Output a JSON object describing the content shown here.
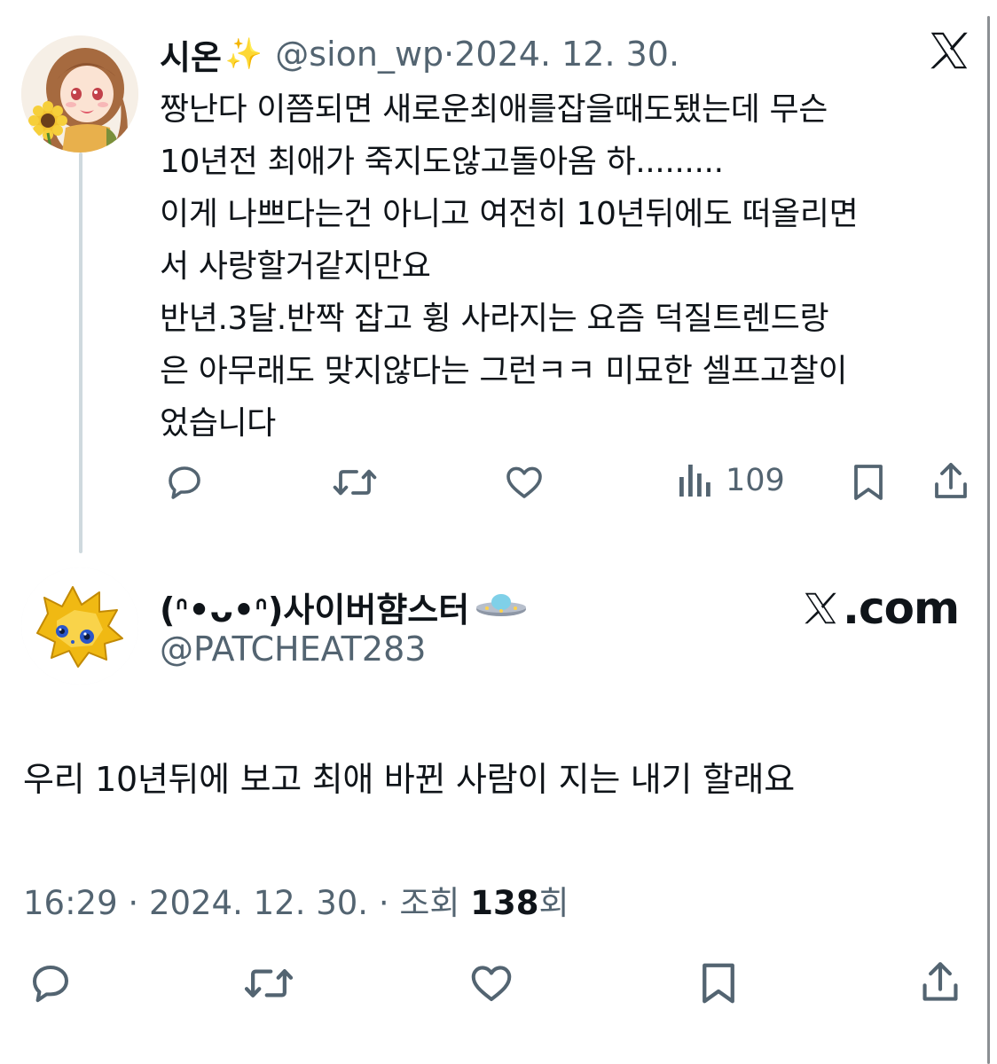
{
  "tweet": {
    "author_name": "시온",
    "author_emoji": "✨",
    "handle": "@sion_wp",
    "separator": " · ",
    "date": "2024. 12. 30.",
    "text": "짱난다 이쯤되면 새로운최애를잡을때도됐는데 무슨\n10년전 최애가 죽지도않고돌아옴 하.........\n이게 나쁘다는건 아니고 여전히 10년뒤에도 떠올리면\n서 사랑할거같지만요\n반년.3달.반짝 잡고 휭 사라지는 요즘 덕질트렌드랑\n은 아무래도 맞지않다는 그런ㅋㅋ 미묘한 셀프고찰이\n었습니다",
    "views": "109"
  },
  "reply": {
    "author_name": "(ᐢ•ᴗ•ᐢ)사이버햠스터",
    "author_emoji": "🛸",
    "handle": "@PATCHEAT283",
    "site_label": ".com",
    "text": "우리 10년뒤에 보고 최애 바뀐 사람이 지는 내기 할래요",
    "time": "16:29",
    "separator": " · ",
    "date": "2024. 12. 30.",
    "views_label": "조회",
    "views_count": "138",
    "views_suffix": "회"
  },
  "icons": {
    "reply": "reply-icon",
    "retweet": "retweet-icon",
    "like": "heart-icon",
    "views": "views-chart-icon",
    "bookmark": "bookmark-icon",
    "share": "share-icon",
    "x_logo": "x-logo-icon"
  },
  "colors": {
    "text": "#0f1419",
    "muted": "#536471",
    "thread_line": "#cfd9de"
  }
}
